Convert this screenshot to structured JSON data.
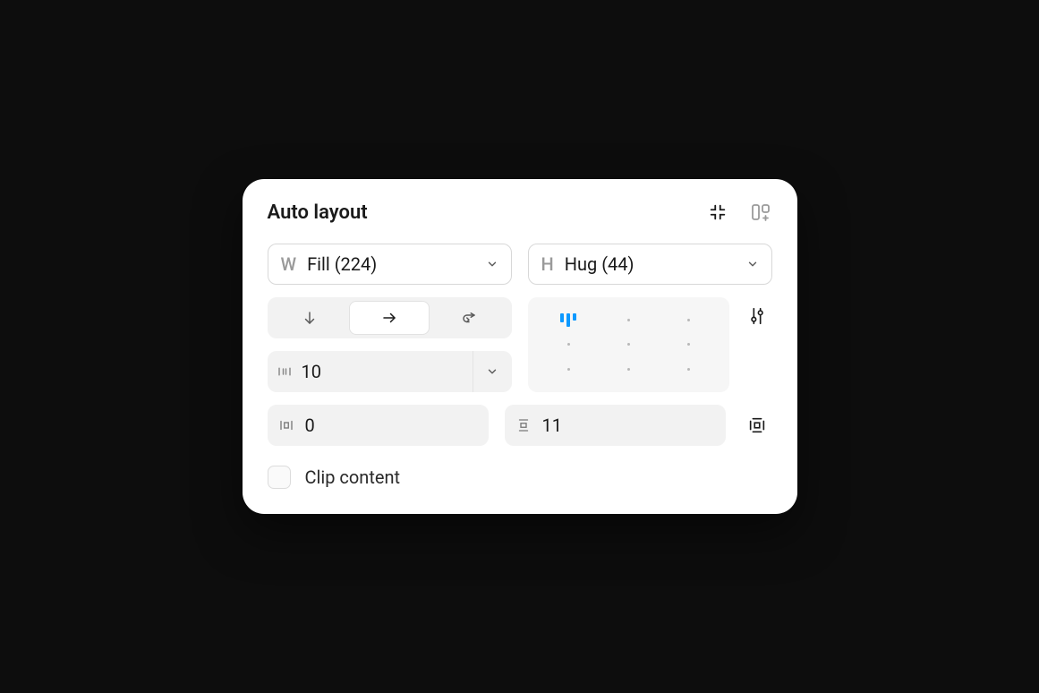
{
  "panel": {
    "title": "Auto layout"
  },
  "size": {
    "width": {
      "label": "W",
      "value": "Fill (224)"
    },
    "height": {
      "label": "H",
      "value": "Hug (44)"
    }
  },
  "gap": {
    "value": "10"
  },
  "padding": {
    "horizontal": "0",
    "vertical": "11"
  },
  "clip": {
    "label": "Clip content",
    "checked": false
  }
}
